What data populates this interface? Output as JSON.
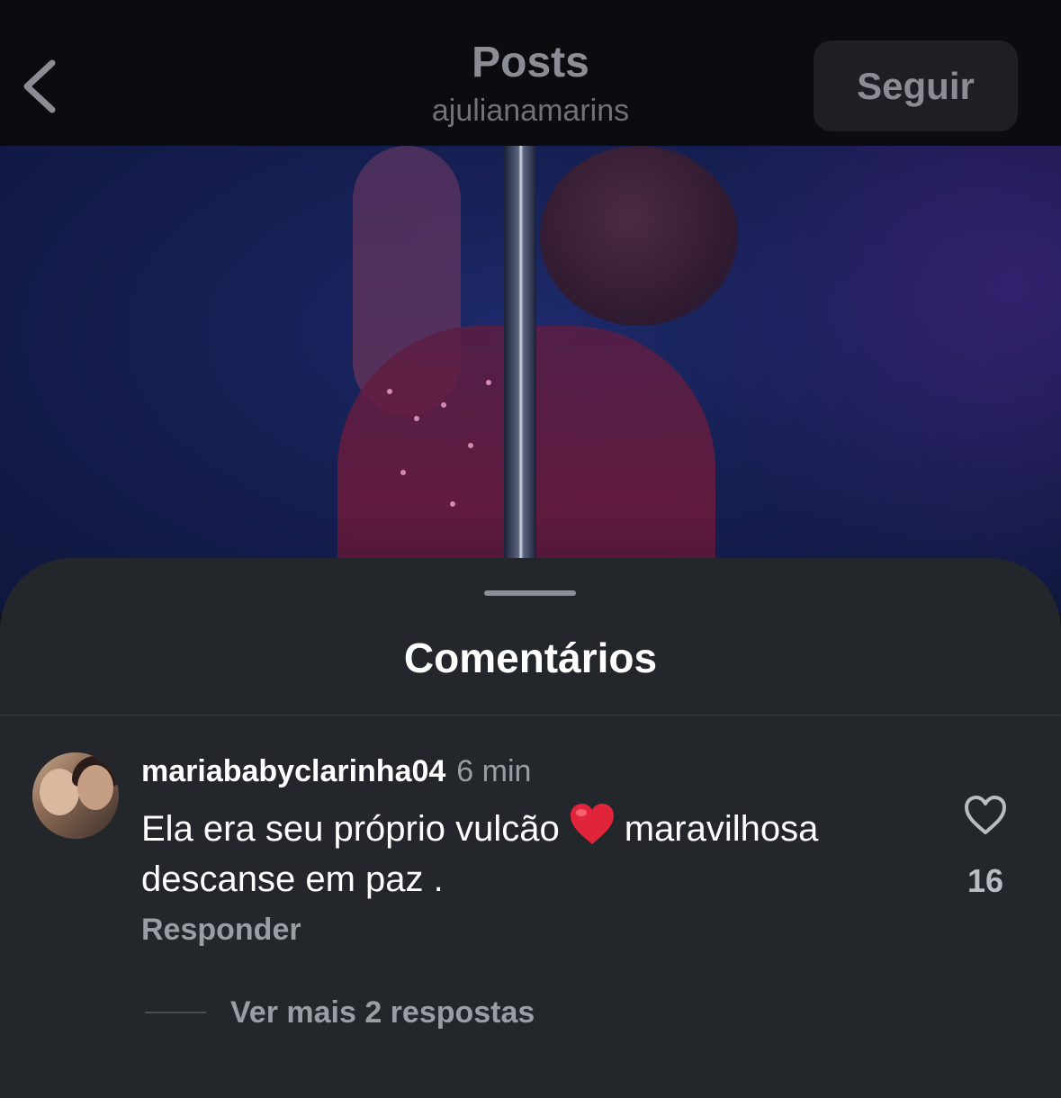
{
  "header": {
    "title": "Posts",
    "subtitle": "ajulianamarins",
    "follow_label": "Seguir",
    "back_icon": "chevron-left-icon"
  },
  "sheet": {
    "title": "Comentários",
    "comments": [
      {
        "username": "mariababyclarinha04",
        "time": "6 min",
        "text_before_emoji": "Ela era seu próprio vulcão",
        "emoji": "red-heart",
        "text_after_emoji": "maravilhosa descanse em paz .",
        "reply_label": "Responder",
        "like_count": "16",
        "more_replies_label": "Ver mais 2 respostas"
      }
    ]
  },
  "colors": {
    "sheet_bg": "#23262b",
    "header_bg": "#0b0c10",
    "secondary_text": "#9a9da3",
    "heart_red": "#e0243a"
  }
}
